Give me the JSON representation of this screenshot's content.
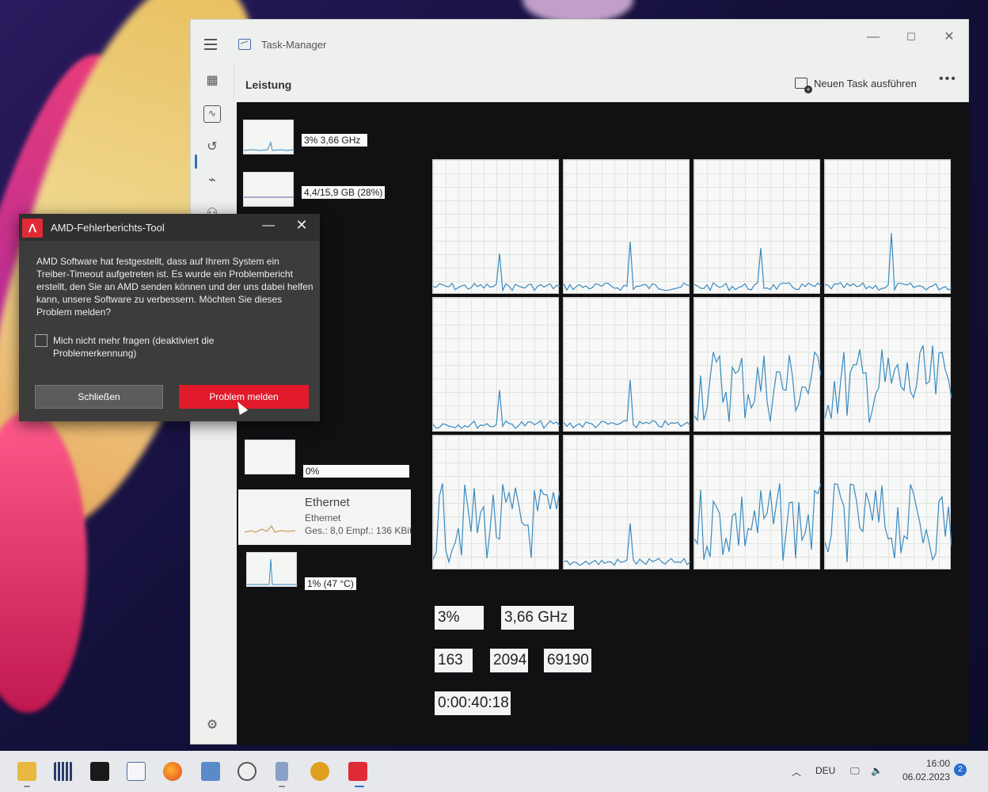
{
  "taskmanager": {
    "title": "Task-Manager",
    "page_title": "Leistung",
    "new_task_label": "Neuen Task ausführen",
    "more_label": "•••",
    "minimize": "—",
    "maximize": "☐",
    "close": "✕"
  },
  "perf_list": {
    "cpu_value": "3% 3,66 GHz",
    "memory_value": "4,4/15,9 GB (28%)",
    "disk_value": "0%",
    "ethernet": {
      "title": "Ethernet",
      "subtitle": "Ethernet",
      "value": "Ges.: 8,0 Empf.: 136 KBit"
    },
    "gpu_value": "1% (47 °C)"
  },
  "cpu_stats": {
    "utilization": "3%",
    "speed": "3,66 GHz",
    "processes": "163",
    "threads": "2094",
    "handles": "69190",
    "uptime": "0:00:40:18"
  },
  "amd_dialog": {
    "title": "AMD-Fehlerberichts-Tool",
    "logo": "ꓥ",
    "message": "AMD Software hat festgestellt, dass auf Ihrem System ein Treiber-Timeout aufgetreten ist. Es wurde ein Problembericht erstellt, den Sie an AMD senden können und der uns dabei helfen kann, unsere Software zu verbessern. Möchten Sie dieses Problem melden?",
    "checkbox_label": "Mich nicht mehr fragen (deaktiviert die Problemerkennung)",
    "close_button": "Schließen",
    "report_button": "Problem melden",
    "minimize": "—",
    "close": "✕"
  },
  "taskbar": {
    "language": "DEU",
    "time": "16:00",
    "date": "06.02.2023",
    "notifications": "2",
    "icons": [
      "file-explorer-icon",
      "equalizer-icon",
      "terminal-icon",
      "performance-monitor-icon",
      "firefox-icon",
      "system-info-icon",
      "clock-icon",
      "benchmark-icon",
      "lambda-icon",
      "amd-icon"
    ]
  }
}
